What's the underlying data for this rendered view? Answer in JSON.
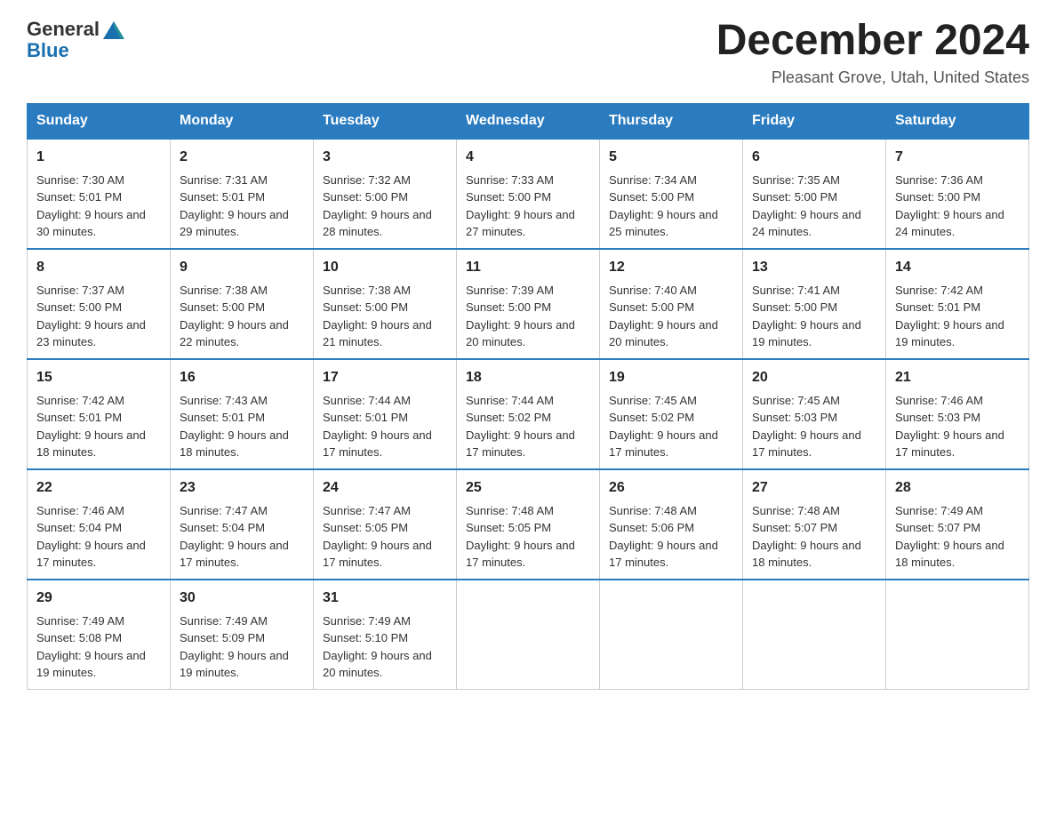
{
  "header": {
    "logo_text_general": "General",
    "logo_text_blue": "Blue",
    "main_title": "December 2024",
    "subtitle": "Pleasant Grove, Utah, United States"
  },
  "weekdays": [
    "Sunday",
    "Monday",
    "Tuesday",
    "Wednesday",
    "Thursday",
    "Friday",
    "Saturday"
  ],
  "weeks": [
    [
      {
        "day": "1",
        "sunrise": "7:30 AM",
        "sunset": "5:01 PM",
        "daylight": "9 hours and 30 minutes."
      },
      {
        "day": "2",
        "sunrise": "7:31 AM",
        "sunset": "5:01 PM",
        "daylight": "9 hours and 29 minutes."
      },
      {
        "day": "3",
        "sunrise": "7:32 AM",
        "sunset": "5:00 PM",
        "daylight": "9 hours and 28 minutes."
      },
      {
        "day": "4",
        "sunrise": "7:33 AM",
        "sunset": "5:00 PM",
        "daylight": "9 hours and 27 minutes."
      },
      {
        "day": "5",
        "sunrise": "7:34 AM",
        "sunset": "5:00 PM",
        "daylight": "9 hours and 25 minutes."
      },
      {
        "day": "6",
        "sunrise": "7:35 AM",
        "sunset": "5:00 PM",
        "daylight": "9 hours and 24 minutes."
      },
      {
        "day": "7",
        "sunrise": "7:36 AM",
        "sunset": "5:00 PM",
        "daylight": "9 hours and 24 minutes."
      }
    ],
    [
      {
        "day": "8",
        "sunrise": "7:37 AM",
        "sunset": "5:00 PM",
        "daylight": "9 hours and 23 minutes."
      },
      {
        "day": "9",
        "sunrise": "7:38 AM",
        "sunset": "5:00 PM",
        "daylight": "9 hours and 22 minutes."
      },
      {
        "day": "10",
        "sunrise": "7:38 AM",
        "sunset": "5:00 PM",
        "daylight": "9 hours and 21 minutes."
      },
      {
        "day": "11",
        "sunrise": "7:39 AM",
        "sunset": "5:00 PM",
        "daylight": "9 hours and 20 minutes."
      },
      {
        "day": "12",
        "sunrise": "7:40 AM",
        "sunset": "5:00 PM",
        "daylight": "9 hours and 20 minutes."
      },
      {
        "day": "13",
        "sunrise": "7:41 AM",
        "sunset": "5:00 PM",
        "daylight": "9 hours and 19 minutes."
      },
      {
        "day": "14",
        "sunrise": "7:42 AM",
        "sunset": "5:01 PM",
        "daylight": "9 hours and 19 minutes."
      }
    ],
    [
      {
        "day": "15",
        "sunrise": "7:42 AM",
        "sunset": "5:01 PM",
        "daylight": "9 hours and 18 minutes."
      },
      {
        "day": "16",
        "sunrise": "7:43 AM",
        "sunset": "5:01 PM",
        "daylight": "9 hours and 18 minutes."
      },
      {
        "day": "17",
        "sunrise": "7:44 AM",
        "sunset": "5:01 PM",
        "daylight": "9 hours and 17 minutes."
      },
      {
        "day": "18",
        "sunrise": "7:44 AM",
        "sunset": "5:02 PM",
        "daylight": "9 hours and 17 minutes."
      },
      {
        "day": "19",
        "sunrise": "7:45 AM",
        "sunset": "5:02 PM",
        "daylight": "9 hours and 17 minutes."
      },
      {
        "day": "20",
        "sunrise": "7:45 AM",
        "sunset": "5:03 PM",
        "daylight": "9 hours and 17 minutes."
      },
      {
        "day": "21",
        "sunrise": "7:46 AM",
        "sunset": "5:03 PM",
        "daylight": "9 hours and 17 minutes."
      }
    ],
    [
      {
        "day": "22",
        "sunrise": "7:46 AM",
        "sunset": "5:04 PM",
        "daylight": "9 hours and 17 minutes."
      },
      {
        "day": "23",
        "sunrise": "7:47 AM",
        "sunset": "5:04 PM",
        "daylight": "9 hours and 17 minutes."
      },
      {
        "day": "24",
        "sunrise": "7:47 AM",
        "sunset": "5:05 PM",
        "daylight": "9 hours and 17 minutes."
      },
      {
        "day": "25",
        "sunrise": "7:48 AM",
        "sunset": "5:05 PM",
        "daylight": "9 hours and 17 minutes."
      },
      {
        "day": "26",
        "sunrise": "7:48 AM",
        "sunset": "5:06 PM",
        "daylight": "9 hours and 17 minutes."
      },
      {
        "day": "27",
        "sunrise": "7:48 AM",
        "sunset": "5:07 PM",
        "daylight": "9 hours and 18 minutes."
      },
      {
        "day": "28",
        "sunrise": "7:49 AM",
        "sunset": "5:07 PM",
        "daylight": "9 hours and 18 minutes."
      }
    ],
    [
      {
        "day": "29",
        "sunrise": "7:49 AM",
        "sunset": "5:08 PM",
        "daylight": "9 hours and 19 minutes."
      },
      {
        "day": "30",
        "sunrise": "7:49 AM",
        "sunset": "5:09 PM",
        "daylight": "9 hours and 19 minutes."
      },
      {
        "day": "31",
        "sunrise": "7:49 AM",
        "sunset": "5:10 PM",
        "daylight": "9 hours and 20 minutes."
      },
      null,
      null,
      null,
      null
    ]
  ]
}
